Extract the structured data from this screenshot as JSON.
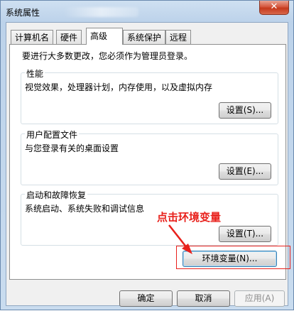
{
  "window": {
    "title": "系统属性",
    "close_glyph": "✕"
  },
  "tabs": [
    {
      "label": "计算机名"
    },
    {
      "label": "硬件"
    },
    {
      "label": "高级"
    },
    {
      "label": "系统保护"
    },
    {
      "label": "远程"
    }
  ],
  "active_tab": "高级",
  "admin_note": "要进行大多数更改，您必须作为管理员登录。",
  "groups": {
    "performance": {
      "title": "性能",
      "description": "视觉效果，处理器计划，内存使用，以及虚拟内存",
      "button": "设置(S)..."
    },
    "profiles": {
      "title": "用户配置文件",
      "description": "与您登录有关的桌面设置",
      "button": "设置(E)..."
    },
    "startup": {
      "title": "启动和故障恢复",
      "description": "系统启动、系统失败和调试信息",
      "button": "设置(T)..."
    }
  },
  "env_button": "环境变量(N)...",
  "annotation": {
    "text": "点击环境变量",
    "color": "#e8201b"
  },
  "footer": {
    "ok": "确定",
    "cancel": "取消",
    "apply": "应用(A)"
  }
}
